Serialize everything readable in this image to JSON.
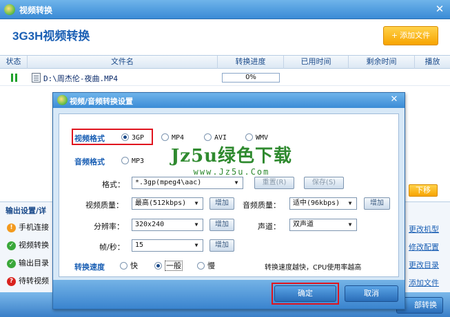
{
  "window": {
    "title": "视频转换"
  },
  "header": {
    "app_heading": "3G3H视频转换",
    "add_file_label": "添加文件"
  },
  "table": {
    "columns": [
      "状态",
      "文件名",
      "转换进度",
      "已用时间",
      "剩余时间",
      "播放"
    ],
    "rows": [
      {
        "file": "D:\\周杰伦-夜曲.MP4",
        "progress": "0%"
      }
    ]
  },
  "side": {
    "down_label": "下移"
  },
  "settings": {
    "title": "输出设置/详",
    "rows": [
      {
        "text": "手机连接",
        "status": "warning",
        "link": "更改机型"
      },
      {
        "text": "视频转换",
        "status": "ok",
        "link": "修改配置"
      },
      {
        "text": "输出目录",
        "status": "ok",
        "link": "更改目录"
      },
      {
        "text": "待转视频",
        "status": "error",
        "link": "添加文件"
      }
    ]
  },
  "bottom": {
    "convert_all_label": "部转换"
  },
  "dialog": {
    "title": "视频/音频转换设置",
    "video_format_label": "视频格式",
    "video_formats": [
      "3GP",
      "MP4",
      "AVI",
      "WMV"
    ],
    "video_format_selected": "3GP",
    "audio_format_label": "音频格式",
    "audio_formats": [
      "MP3"
    ],
    "format_label": "格式：",
    "format_value": "*.3gp(mpeg4\\aac)",
    "reset_label": "重置(R)",
    "save_label": "保存(S)",
    "video_quality_label": "视频质量：",
    "video_quality_value": "最高(512kbps)",
    "audio_quality_label": "音频质量：",
    "audio_quality_value": "适中(96kbps)",
    "resolution_label": "分辨率：",
    "resolution_value": "320x240",
    "channel_label": "声道：",
    "channel_value": "双声道",
    "fps_label": "帧/秒：",
    "fps_value": "15",
    "increase_label": "增加",
    "speed_label": "转换速度",
    "speed_options": [
      "快",
      "一般",
      "慢"
    ],
    "speed_selected": "一般",
    "speed_note": "转换速度越快，CPU使用率越高",
    "ok_label": "确定",
    "cancel_label": "取消"
  },
  "watermark": {
    "line1": "Jz5u绿色下载",
    "line2": "www.Jz5u.Com"
  },
  "colors": {
    "accent_blue": "#3a8bd6",
    "highlight_red": "#e0141e",
    "orange": "#f7a400"
  }
}
